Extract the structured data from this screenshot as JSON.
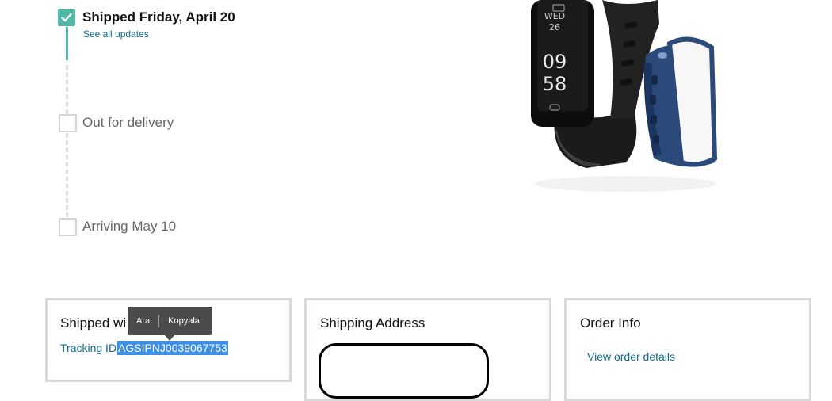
{
  "timeline": {
    "steps": [
      {
        "title": "Shipped Friday, April 20",
        "link": "See all updates",
        "done": true
      },
      {
        "title": "Out for delivery",
        "done": false
      },
      {
        "title": "Arriving May 10",
        "done": false
      }
    ]
  },
  "product": {
    "watch_day": "WED",
    "watch_date": "26",
    "watch_hour": "09",
    "watch_minute": "58"
  },
  "cards": {
    "shipped_with": {
      "title_visible": "Shipped wi",
      "tracking_label": "Tracking ID",
      "tracking_id": "AGSIPNJ0039067753"
    },
    "shipping_address": {
      "title": "Shipping Address"
    },
    "order_info": {
      "title": "Order Info",
      "link": "View order details"
    }
  },
  "context_popup": {
    "search_label": "Ara",
    "copy_label": "Kopyala"
  },
  "colors": {
    "accent": "#4fb8a8",
    "link": "#0c6b8a",
    "selection": "#3b8fe6",
    "card_border": "#d5dbdb"
  }
}
